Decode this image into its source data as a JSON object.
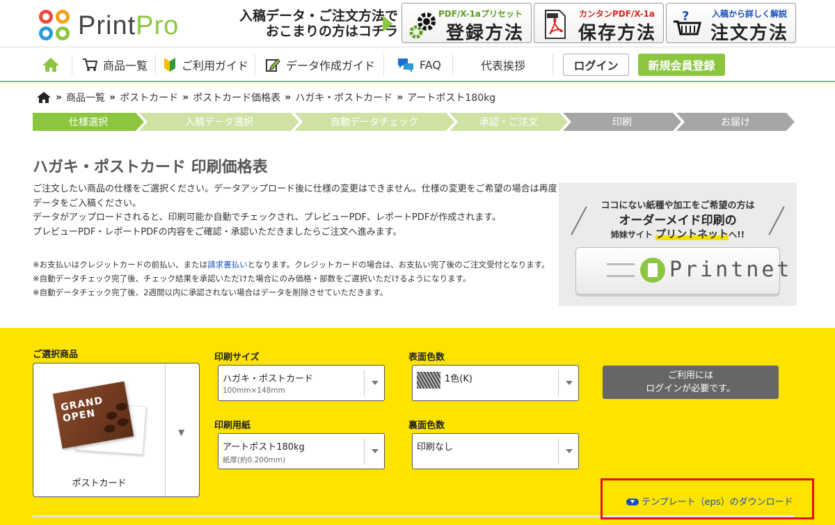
{
  "header": {
    "logo_text_a": "Print",
    "logo_text_b": "Pro",
    "promo_line1": "入稿データ・ご注文方法で",
    "promo_line2": "おこまりの方はコチラ",
    "guides": [
      {
        "sub": "PDF/X-1aプリセット",
        "main": "登録方法",
        "icon": "gear-icon"
      },
      {
        "sub": "カンタンPDF/X-1a",
        "main": "保存方法",
        "icon": "pdf-file-icon"
      },
      {
        "sub": "入稿から詳しく解説",
        "main": "注文方法",
        "icon": "cart-question-icon"
      }
    ]
  },
  "nav": {
    "items": [
      "商品一覧",
      "ご利用ガイド",
      "データ作成ガイド",
      "FAQ",
      "代表挨拶"
    ],
    "login": "ログイン",
    "register": "新規会員登録"
  },
  "breadcrumb": [
    "商品一覧",
    "ポストカード",
    "ポストカード価格表",
    "ハガキ・ポストカード",
    "アートポスト180kg"
  ],
  "steps": [
    {
      "label": "仕様選択",
      "color": "#8cc63f"
    },
    {
      "label": "入稿データ選択",
      "color": "#cfe2a4"
    },
    {
      "label": "自動データチェック",
      "color": "#cfe2a4"
    },
    {
      "label": "承認・ご注文",
      "color": "#cfe2a4"
    },
    {
      "label": "印刷",
      "color": "#a6a6a6"
    },
    {
      "label": "お届け",
      "color": "#a6a6a6"
    }
  ],
  "page": {
    "title": "ハガキ・ポストカード 印刷価格表",
    "intro": [
      "ご注文したい商品の仕様をご選択ください。データアップロード後に仕様の変更はできません。仕様の変更をご希望の場合は再度データをご入稿ください。",
      "データがアップロードされると、印刷可能か自動でチェックされ、プレビューPDF、レポートPDFが作成されます。",
      "プレビューPDF・レポートPDFの内容をご確認・承認いただきましたらご注文へ進みます。"
    ],
    "note1_a": "※お支払いはクレジットカードの前払い、または",
    "note1_link": "請求書払い",
    "note1_b": "となります。クレジットカードの場合は、お支払い完了後のご注文受付となります。",
    "note2": "※自動データチェック完了後、チェック結果を承認いただけた場合にのみ価格・部数をご選択いただけるようになります。",
    "note3": "※自動データチェック完了後、2週間以内に承認されない場合はデータを削除させていただきます。"
  },
  "banner": {
    "line1": "ココにない紙種や加工をご希望の方は",
    "line2": "オーダーメイド印刷の",
    "line3_a": "姉妹サイト",
    "line3_b": "プリントネット",
    "line3_c": "へ!!",
    "button_text": "Printnet"
  },
  "config": {
    "product_label": "ご選択商品",
    "product_caption": "ポストカード",
    "product_image_text": "GRAND OPEN",
    "size_label": "印刷サイズ",
    "size_value": "ハガキ・ポストカード",
    "size_sub": "100mm×148mm",
    "paper_label": "印刷用紙",
    "paper_value": "アートポスト180kg",
    "paper_sub": "紙厚(約0.200mm)",
    "front_label": "表面色数",
    "front_value": "1色(K)",
    "back_label": "裏面色数",
    "back_value": "印刷なし",
    "login_required": "ご利用には\nログインが必要です。",
    "template_link": "テンプレート（eps）のダウンロード"
  }
}
